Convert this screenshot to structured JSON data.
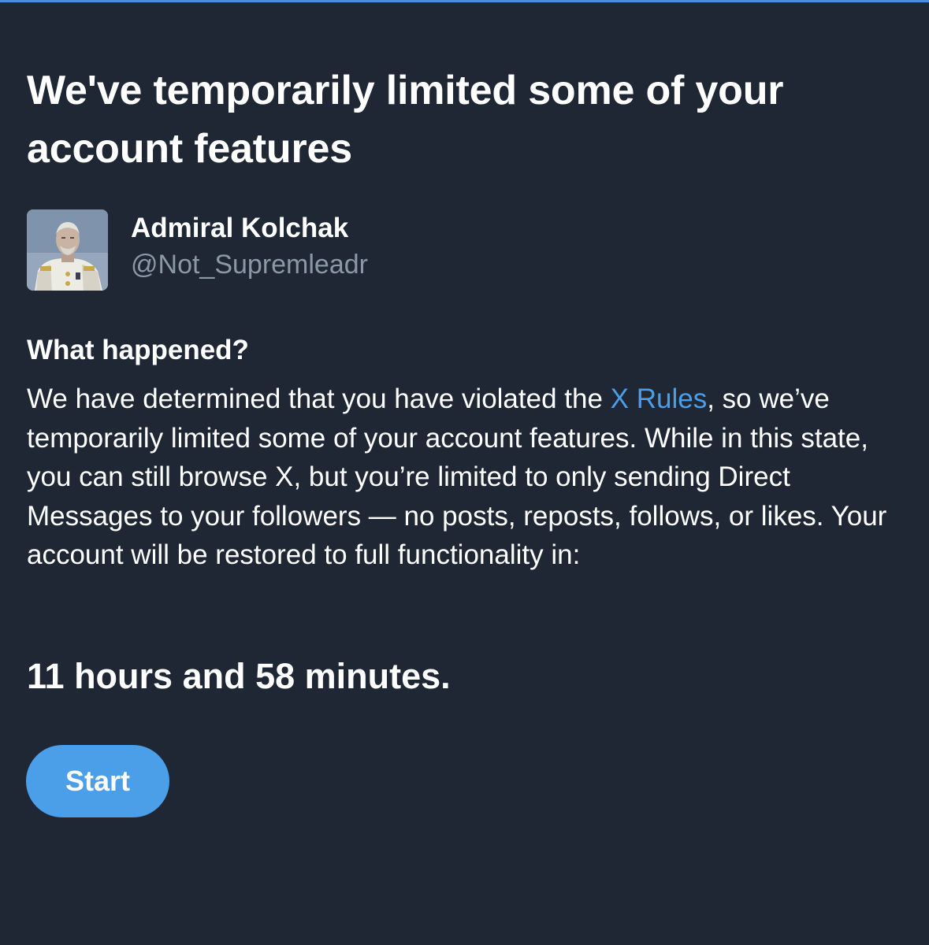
{
  "header": {
    "title": "We've temporarily limited some of your account features"
  },
  "account": {
    "display_name": "Admiral Kolchak",
    "handle": "@Not_Supremleadr",
    "avatar": "portrait-avatar"
  },
  "details": {
    "heading": "What happened?",
    "text_before_link": "We have determined that you have violated the ",
    "link_label": "X Rules",
    "text_after_link": ", so we’ve temporarily limited some of your account features. While in this state, you can still browse X, but you’re limited to only sending Direct Messages to your followers — no posts, reposts, follows, or likes. Your account will be restored to full functionality in:"
  },
  "countdown": {
    "text": "11 hours and 58 minutes."
  },
  "actions": {
    "start_label": "Start"
  },
  "colors": {
    "background": "#1f2734",
    "accent": "#4a9fe8",
    "secondary_text": "#8b98a5",
    "top_border": "#4a90d9"
  }
}
